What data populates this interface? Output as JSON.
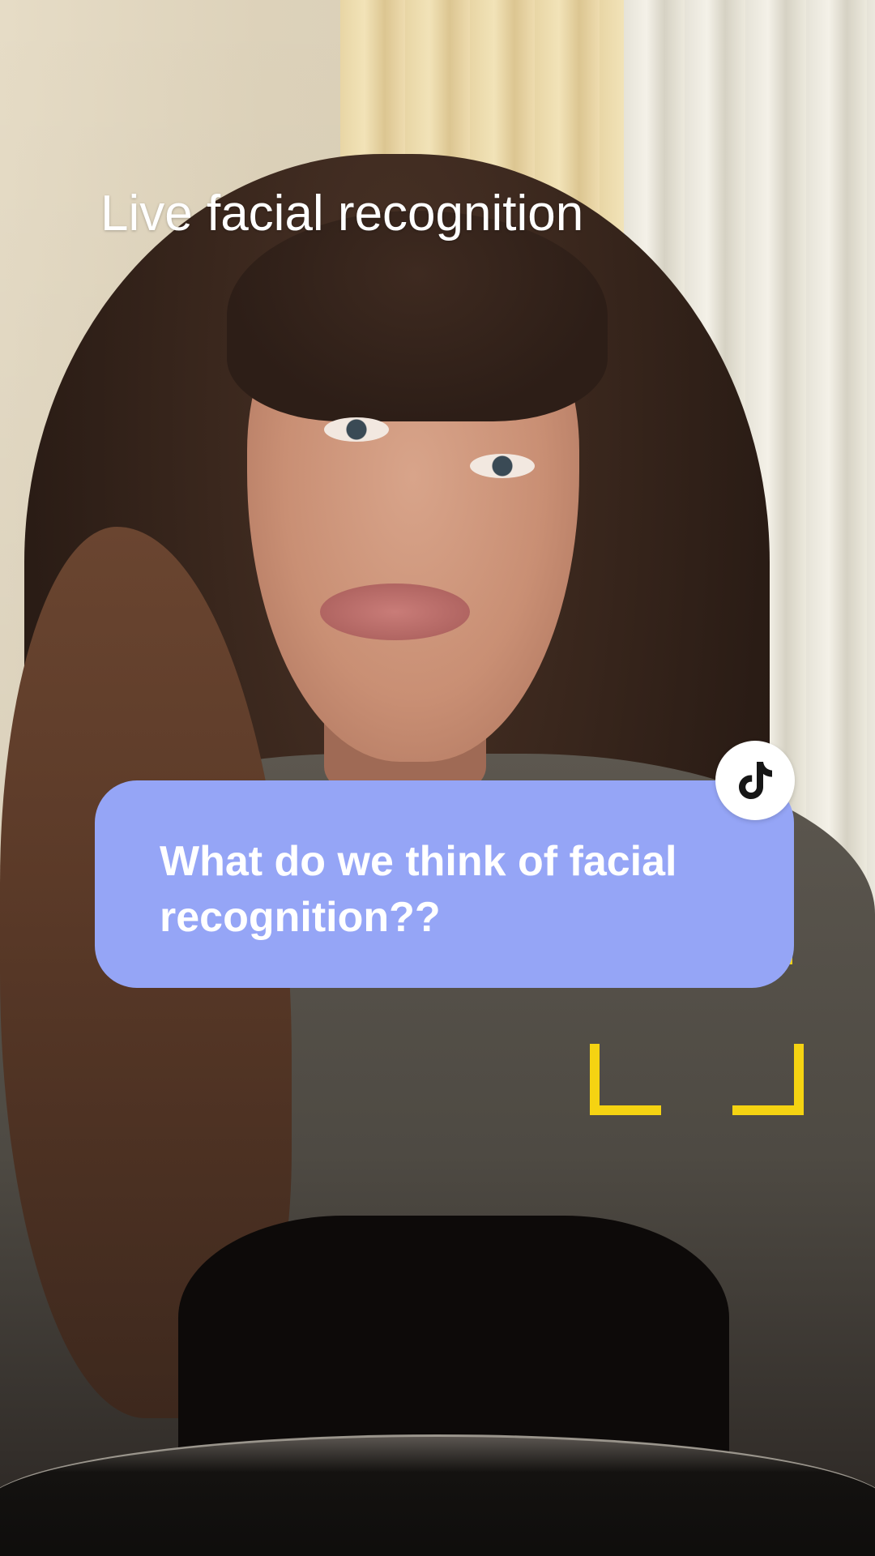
{
  "overlay": {
    "title": "Live facial recognition"
  },
  "bubble": {
    "text": "What do we think of facial recognition??",
    "background_color": "#95a5f6",
    "badge_icon": "tiktok-logo-icon"
  },
  "focus_frame": {
    "color": "#f5d312"
  }
}
